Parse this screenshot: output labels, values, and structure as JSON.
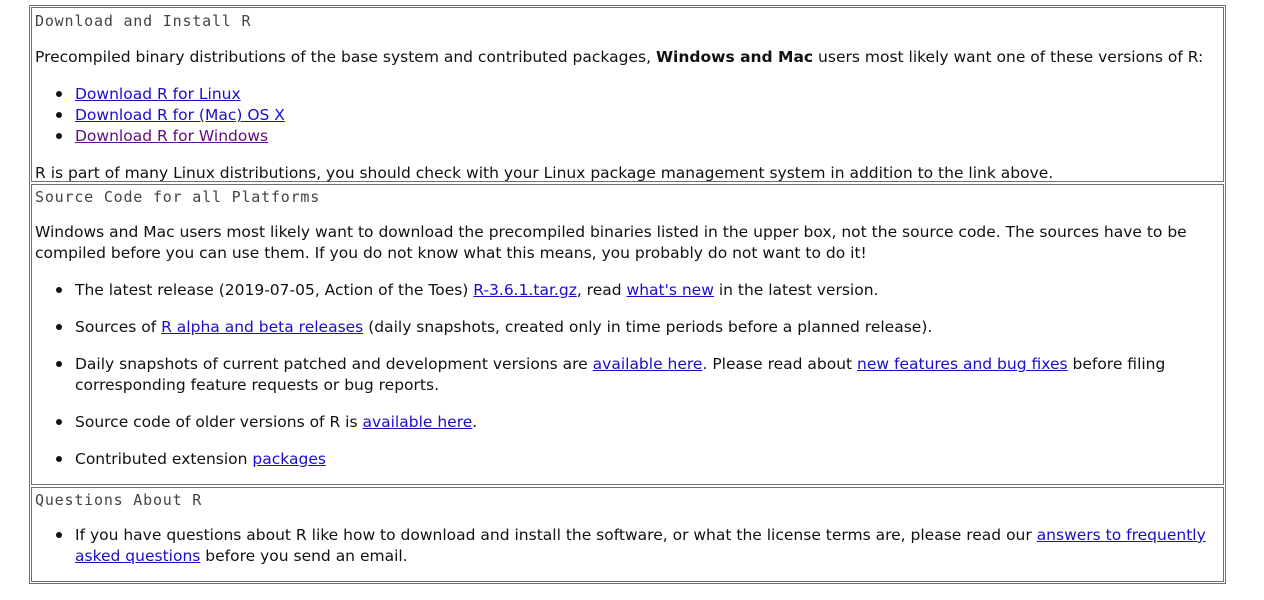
{
  "sections": {
    "download": {
      "title": "Download and Install R",
      "intro_before": "Precompiled binary distributions of the base system and contributed packages, ",
      "intro_bold": "Windows and Mac",
      "intro_after": " users most likely want one of these versions of R:",
      "links": [
        {
          "label": "Download R for Linux"
        },
        {
          "label": "Download R for (Mac) OS X"
        },
        {
          "label": "Download R for Windows"
        }
      ],
      "footer": "R is part of many Linux distributions, you should check with your Linux package management system in addition to the link above."
    },
    "source": {
      "title": "Source Code for all Platforms",
      "intro": "Windows and Mac users most likely want to download the precompiled binaries listed in the upper box, not the source code. The sources have to be compiled before you can use them. If you do not know what this means, you probably do not want to do it!",
      "item1": {
        "before": "The latest release (2019-07-05, Action of the Toes) ",
        "link1": "R-3.6.1.tar.gz",
        "middle": ", read ",
        "link2": "what's new",
        "after": " in the latest version."
      },
      "item2": {
        "before": "Sources of ",
        "link": "R alpha and beta releases",
        "after": " (daily snapshots, created only in time periods before a planned release)."
      },
      "item3": {
        "before": "Daily snapshots of current patched and development versions are ",
        "link1": "available here",
        "middle": ". Please read about ",
        "link2": "new features and bug fixes",
        "after": " before filing corresponding feature requests or bug reports."
      },
      "item4": {
        "before": "Source code of older versions of R is ",
        "link": "available here",
        "after": "."
      },
      "item5": {
        "before": "Contributed extension ",
        "link": "packages"
      }
    },
    "questions": {
      "title": "Questions About R",
      "item": {
        "before": "If you have questions about R like how to download and install the software, or what the license terms are, please read our ",
        "link": "answers to frequently asked questions",
        "after": " before you send an email."
      }
    }
  }
}
